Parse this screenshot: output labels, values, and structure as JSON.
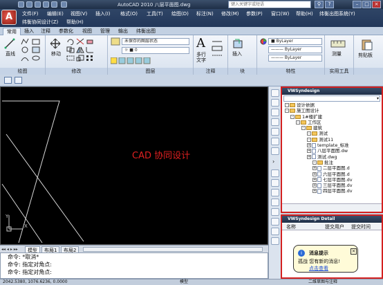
{
  "titlebar": {
    "title": "AutoCAD 2010  八层平面图.dwg",
    "search_placeholder": "键入关键字或短语"
  },
  "menu": {
    "items": [
      "文件(F)",
      "编辑(E)",
      "视图(V)",
      "插入(I)",
      "格式(O)",
      "工具(T)",
      "绘图(D)",
      "标注(N)",
      "修改(M)",
      "参数(P)",
      "窗口(W)",
      "帮助(H)",
      "纬衡出图系统(Y)",
      "纬衡协同设计(Z)",
      "帮助(H)"
    ]
  },
  "tabs": [
    "常用",
    "插入",
    "注释",
    "参数化",
    "视图",
    "管理",
    "输出",
    "纬衡出图"
  ],
  "ribbon": {
    "draw": {
      "label": "绘图",
      "line": "直线"
    },
    "modify": {
      "label": "修改",
      "move": "移动"
    },
    "layers": {
      "label": "图层",
      "state": "未保存的图层状态"
    },
    "annotation": {
      "label": "注释",
      "text": "多行\n文字"
    },
    "block": {
      "label": "块",
      "insert": "插入"
    },
    "properties": {
      "label": "特性",
      "color": "ByLayer",
      "linetype": "ByLayer",
      "lineweight": "ByLayer"
    },
    "utilities": {
      "label": "实用工具",
      "measure": "测量"
    },
    "clipboard": {
      "label": "",
      "paste": "剪贴板"
    }
  },
  "canvas": {
    "label": "CAD 协同设计",
    "axis_y": "Y",
    "axis_x": "X"
  },
  "model_tabs": [
    "模型",
    "布局1",
    "布局2"
  ],
  "command": {
    "lines": [
      "命令: *取消*",
      "命令: 指定对角点:",
      "命令: 指定对角点:"
    ]
  },
  "status": {
    "coords": "2042.5380, 1076.6236, 0.0000",
    "model": "模型",
    "annoscale": "二维草图与注释"
  },
  "panel_top": {
    "title": "VWSyndesign",
    "tree": [
      {
        "label": "设计依据",
        "indent": 4,
        "kind": "folder"
      },
      {
        "label": "施工图设计",
        "indent": 4,
        "kind": "folder"
      },
      {
        "label": "1#楼扩建",
        "indent": 12,
        "kind": "folder"
      },
      {
        "label": "工作区",
        "indent": 20,
        "kind": "folder"
      },
      {
        "label": "建筑",
        "indent": 28,
        "kind": "folder"
      },
      {
        "label": "测试",
        "indent": 36,
        "kind": "folder"
      },
      {
        "label": "测试11",
        "indent": 36,
        "kind": "folder"
      },
      {
        "label": "template_标准",
        "indent": 36,
        "kind": "file"
      },
      {
        "label": "八层平面图.dw",
        "indent": 36,
        "kind": "file"
      },
      {
        "label": "测试.dwg",
        "indent": 36,
        "kind": "file"
      },
      {
        "label": "批注",
        "indent": 44,
        "kind": "folder"
      },
      {
        "label": "二层平面图.d",
        "indent": 44,
        "kind": "file"
      },
      {
        "label": "六层平面图.d",
        "indent": 44,
        "kind": "file"
      },
      {
        "label": "七层平面图.dv",
        "indent": 44,
        "kind": "file"
      },
      {
        "label": "三层平面图.dv",
        "indent": 44,
        "kind": "file"
      },
      {
        "label": "四层平面图.dv",
        "indent": 44,
        "kind": "file"
      }
    ]
  },
  "panel_detail": {
    "title": "VWSyndesign Detail",
    "columns": [
      "名称",
      "提交用户",
      "提交时间"
    ]
  },
  "popup": {
    "title": "消息提示",
    "body": "孤战  您有新的消息!",
    "link": "点击查看"
  },
  "colors": {
    "title_bg": "#1f2f47",
    "accent_red": "#d42020",
    "canvas_bg": "#000000"
  }
}
